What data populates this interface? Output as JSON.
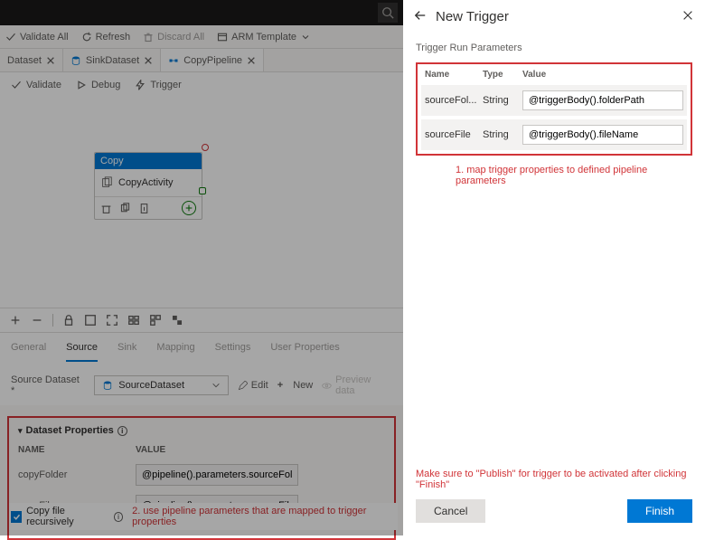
{
  "toolbar": {
    "validate_all": "Validate All",
    "refresh": "Refresh",
    "discard_all": "Discard All",
    "arm_template": "ARM Template"
  },
  "tabs": [
    {
      "label": "Dataset"
    },
    {
      "label": "SinkDataset"
    },
    {
      "label": "CopyPipeline"
    }
  ],
  "pipeline_bar": {
    "validate": "Validate",
    "debug": "Debug",
    "trigger": "Trigger"
  },
  "activity": {
    "header": "Copy",
    "name": "CopyActivity"
  },
  "prop_tabs": [
    "General",
    "Source",
    "Sink",
    "Mapping",
    "Settings",
    "User Properties"
  ],
  "source": {
    "label": "Source Dataset *",
    "selected": "SourceDataset",
    "edit": "Edit",
    "new": "New",
    "preview": "Preview data"
  },
  "dataset_props": {
    "title": "Dataset Properties",
    "headers": {
      "name": "NAME",
      "value": "VALUE"
    },
    "rows": [
      {
        "name": "copyFolder",
        "value": "@pipeline().parameters.sourceFolder"
      },
      {
        "name": "copyFile",
        "value": "@pipeline().parameters.sourceFile"
      }
    ]
  },
  "copy_recursive": "Copy file recursively",
  "annotations": {
    "a1": "1. map trigger properties to defined pipeline parameters",
    "a2": "2. use pipeline parameters that are mapped to trigger properties"
  },
  "panel": {
    "title": "New Trigger",
    "section": "Trigger Run Parameters",
    "headers": {
      "name": "Name",
      "type": "Type",
      "value": "Value"
    },
    "params": [
      {
        "name": "sourceFol...",
        "type": "String",
        "value": "@triggerBody().folderPath"
      },
      {
        "name": "sourceFile",
        "type": "String",
        "value": "@triggerBody().fileName"
      }
    ],
    "note": "Make sure to \"Publish\" for trigger to be activated after clicking \"Finish\"",
    "cancel": "Cancel",
    "finish": "Finish"
  }
}
